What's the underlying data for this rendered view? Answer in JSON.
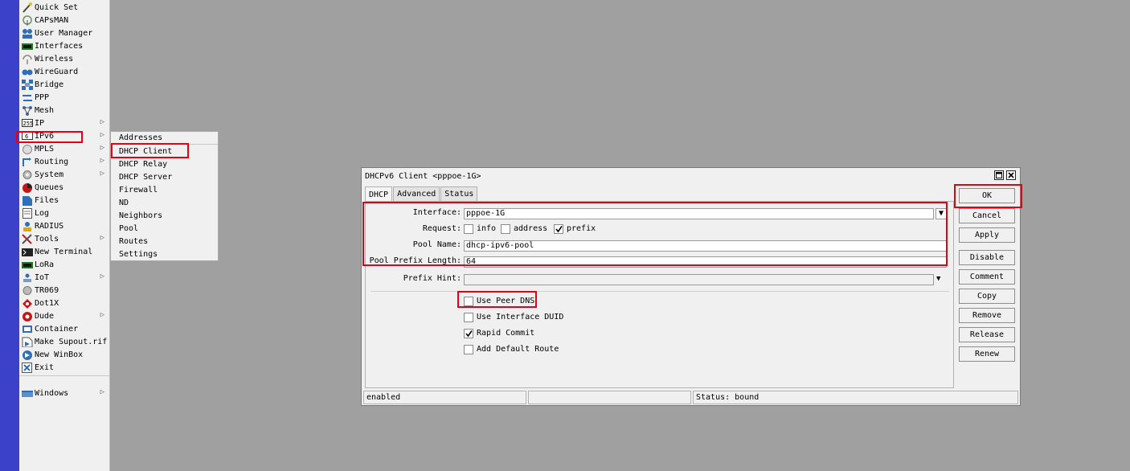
{
  "sidebar": {
    "items": [
      {
        "label": "Quick Set",
        "icon": "wand-icon"
      },
      {
        "label": "CAPsMAN",
        "icon": "antenna-icon"
      },
      {
        "label": "User Manager",
        "icon": "users-icon"
      },
      {
        "label": "Interfaces",
        "icon": "interfaces-icon"
      },
      {
        "label": "Wireless",
        "icon": "wireless-icon"
      },
      {
        "label": "WireGuard",
        "icon": "wireguard-icon"
      },
      {
        "label": "Bridge",
        "icon": "bridge-icon"
      },
      {
        "label": "PPP",
        "icon": "ppp-icon"
      },
      {
        "label": "Mesh",
        "icon": "mesh-icon"
      },
      {
        "label": "IP",
        "icon": "ip-icon"
      },
      {
        "label": "IPv6",
        "icon": "ipv6-icon"
      },
      {
        "label": "MPLS",
        "icon": "mpls-icon"
      },
      {
        "label": "Routing",
        "icon": "routing-icon"
      },
      {
        "label": "System",
        "icon": "gear-icon"
      },
      {
        "label": "Queues",
        "icon": "queues-icon"
      },
      {
        "label": "Files",
        "icon": "files-icon"
      },
      {
        "label": "Log",
        "icon": "log-icon"
      },
      {
        "label": "RADIUS",
        "icon": "radius-icon"
      },
      {
        "label": "Tools",
        "icon": "tools-icon"
      },
      {
        "label": "New Terminal",
        "icon": "terminal-icon"
      },
      {
        "label": "LoRa",
        "icon": "lora-icon"
      },
      {
        "label": "IoT",
        "icon": "iot-icon"
      },
      {
        "label": "TR069",
        "icon": "tr069-icon"
      },
      {
        "label": "Dot1X",
        "icon": "dot1x-icon"
      },
      {
        "label": "Dude",
        "icon": "dude-icon"
      },
      {
        "label": "Container",
        "icon": "container-icon"
      },
      {
        "label": "Make Supout.rif",
        "icon": "supout-icon"
      },
      {
        "label": "New WinBox",
        "icon": "winbox-icon"
      },
      {
        "label": "Exit",
        "icon": "exit-icon"
      },
      {
        "label": "Windows",
        "icon": "windows-icon"
      }
    ]
  },
  "submenu": {
    "items": [
      "Addresses",
      "DHCP Client",
      "DHCP Relay",
      "DHCP Server",
      "Firewall",
      "ND",
      "Neighbors",
      "Pool",
      "Routes",
      "Settings"
    ]
  },
  "dialog": {
    "title": "DHCPv6 Client <pppoe-1G>",
    "tabs": [
      "DHCP",
      "Advanced",
      "Status"
    ],
    "interface_label": "Interface:",
    "interface_value": "pppoe-1G",
    "request_label": "Request:",
    "request_options": [
      {
        "label": "info",
        "checked": false
      },
      {
        "label": "address",
        "checked": false
      },
      {
        "label": "prefix",
        "checked": true
      }
    ],
    "pool_name_label": "Pool Name:",
    "pool_name_value": "dhcp-ipv6-pool",
    "pool_prefix_label": "Pool Prefix Length:",
    "pool_prefix_value": "64",
    "prefix_hint_label": "Prefix Hint:",
    "prefix_hint_value": "",
    "checkboxes": [
      {
        "label": "Use Peer DNS",
        "checked": false
      },
      {
        "label": "Use Interface DUID",
        "checked": false
      },
      {
        "label": "Rapid Commit",
        "checked": true
      },
      {
        "label": "Add Default Route",
        "checked": false
      }
    ],
    "buttons": [
      "OK",
      "Cancel",
      "Apply",
      "Disable",
      "Comment",
      "Copy",
      "Remove",
      "Release",
      "Renew"
    ],
    "status": [
      "enabled",
      "",
      "Status: bound"
    ]
  },
  "colors": {
    "highlight": "#e60012",
    "sidebar_strip": "#3b41c8",
    "desktop": "#a0a0a0"
  }
}
